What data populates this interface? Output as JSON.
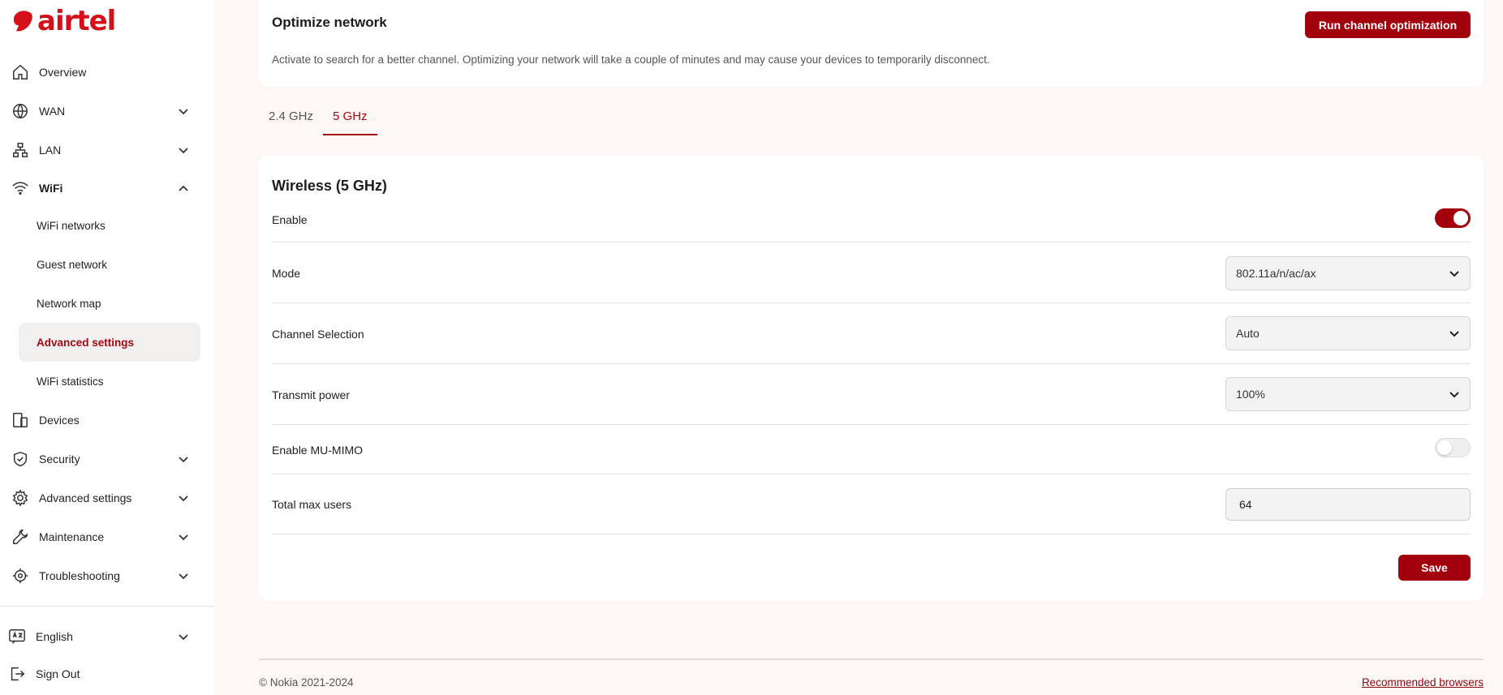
{
  "brand": {
    "name": "airtel",
    "color": "#d4101a"
  },
  "sidebar": {
    "items": [
      {
        "label": "Overview",
        "icon": "home-icon"
      },
      {
        "label": "WAN",
        "icon": "globe-icon"
      },
      {
        "label": "LAN",
        "icon": "network-icon"
      },
      {
        "label": "WiFi",
        "icon": "wifi-icon"
      }
    ],
    "wifi_sub": [
      {
        "label": "WiFi networks"
      },
      {
        "label": "Guest network"
      },
      {
        "label": "Network map"
      },
      {
        "label": "Advanced settings"
      },
      {
        "label": "WiFi statistics"
      }
    ],
    "items2": [
      {
        "label": "Devices",
        "icon": "devices-icon"
      },
      {
        "label": "Security",
        "icon": "shield-icon"
      },
      {
        "label": "Advanced settings",
        "icon": "gear-icon"
      },
      {
        "label": "Maintenance",
        "icon": "wrench-icon"
      },
      {
        "label": "Troubleshooting",
        "icon": "target-icon"
      }
    ],
    "language": "English",
    "sign_out": "Sign Out"
  },
  "optimize": {
    "title": "Optimize network",
    "description": "Activate to search for a better channel. Optimizing your network will take a couple of minutes and may cause your devices to temporarily disconnect.",
    "button": "Run channel optimization"
  },
  "tabs": [
    {
      "label": "2.4 GHz"
    },
    {
      "label": "5 GHz"
    }
  ],
  "wireless": {
    "title": "Wireless (5 GHz)",
    "enable_label": "Enable",
    "enable_on": true,
    "mode_label": "Mode",
    "mode_value": "802.11a/n/ac/ax",
    "channel_label": "Channel Selection",
    "channel_value": "Auto",
    "power_label": "Transmit power",
    "power_value": "100%",
    "mumimo_label": "Enable MU-MIMO",
    "mumimo_on": false,
    "max_users_label": "Total max users",
    "max_users_value": "64",
    "save": "Save"
  },
  "footer": {
    "copyright": "© Nokia 2021-2024",
    "link": "Recommended browsers"
  },
  "colors": {
    "accent": "#a3000d",
    "background": "#fdf7f6"
  }
}
